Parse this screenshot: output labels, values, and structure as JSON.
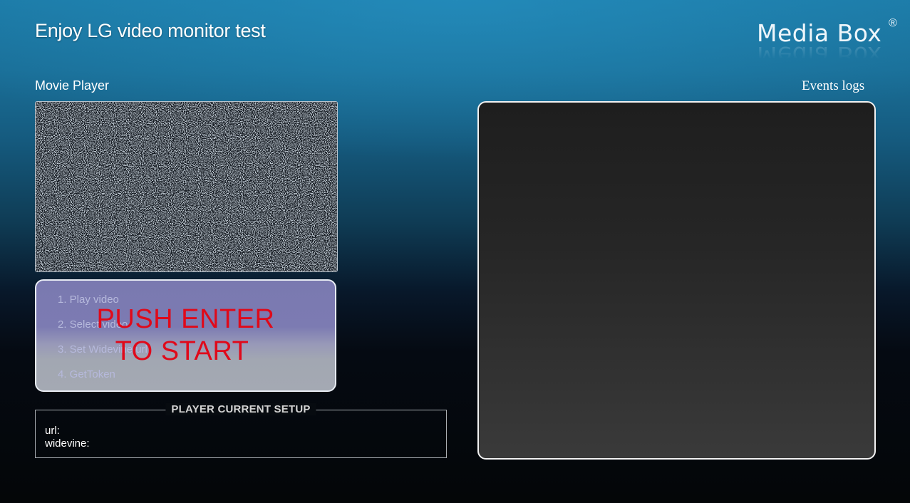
{
  "header": {
    "title": "Enjoy LG video monitor test",
    "logo_text": "Media Box",
    "logo_mark": "®"
  },
  "player": {
    "section_title": "Movie Player",
    "screen_state": "static-noise"
  },
  "menu": {
    "items": [
      {
        "label": "1. Play video"
      },
      {
        "label": "2. Select video"
      },
      {
        "label": "3. Set Widevine url"
      },
      {
        "label": "4. GetToken"
      }
    ],
    "overlay_line1": "PUSH ENTER",
    "overlay_line2": "TO START",
    "overlay_color": "#e0091a"
  },
  "setup": {
    "legend": "PLAYER CURRENT SETUP",
    "url_label": "url:",
    "widevine_label": "widevine:"
  },
  "events": {
    "section_title": "Events logs"
  },
  "colors": {
    "accent_blue": "#1c7aa6",
    "background_dark": "#040608",
    "menu_panel": "#7c7bb2"
  }
}
